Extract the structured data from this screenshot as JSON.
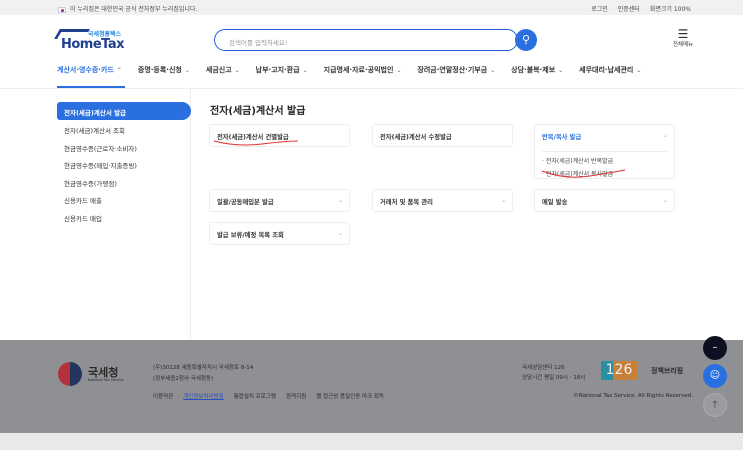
{
  "topbar": {
    "notice": "이 누리집은 대한민국 공식 전자정부 누리집입니다.",
    "login": "로그인",
    "cert": "인증센터",
    "zoom": "화면크기 100%"
  },
  "header": {
    "logo_sub": "국세청홈택스",
    "logo_main": "HomeTax",
    "search_placeholder": "검색어를 입력하세요!",
    "all_menu": "전체메뉴"
  },
  "nav": [
    "계산서·영수증·카드",
    "증명·등록·신청",
    "세금신고",
    "납부·고지·환급",
    "지급명세·자료·공익법인",
    "장려금·연말정산·기부금",
    "상담·불복·제보",
    "세무대리·납세관리"
  ],
  "sidebar": [
    "전자(세금)계산서 발급",
    "전자(세금)계산서 조회",
    "현금영수증(근로자·소비자)",
    "현금영수증(매입·지출증빙)",
    "현금영수증(가맹점)",
    "신용카드 매출",
    "신용카드 매입"
  ],
  "page_title": "전자(세금)계산서 발급",
  "cards": {
    "c1": "전자(세금)계산서 건별발급",
    "c2": "전자(세금)계산서 수정발급",
    "c3": "반복/복사 발급",
    "c3_subs": [
      "전자(세금)계산서 반복발급",
      "전자(세금)계산서 복사발급"
    ],
    "c4": "일괄/공동매입분 발급",
    "c5": "거래처 및 품목 관리",
    "c6": "메일 발송",
    "c7": "발급 보류/예정 목록 조회"
  },
  "footer": {
    "org": "국세청",
    "org_en": "National Tax Service",
    "addr1": "(우)30128 세종특별자치시 국세청로 8-14",
    "addr2": "(정부세종2청사 국세청동)",
    "links": [
      "이용약관",
      "개인정보처리방침",
      "통합설치 프로그램",
      "원격지원",
      "웹 접근성 품질인증 마크 획득"
    ],
    "center": "국세상담센터 126",
    "hours": "상담시간 평일 09시 - 18시",
    "num": "126",
    "brief": "정책브리핑",
    "copyright": "©National Tax Service. All Rights Reserved."
  }
}
